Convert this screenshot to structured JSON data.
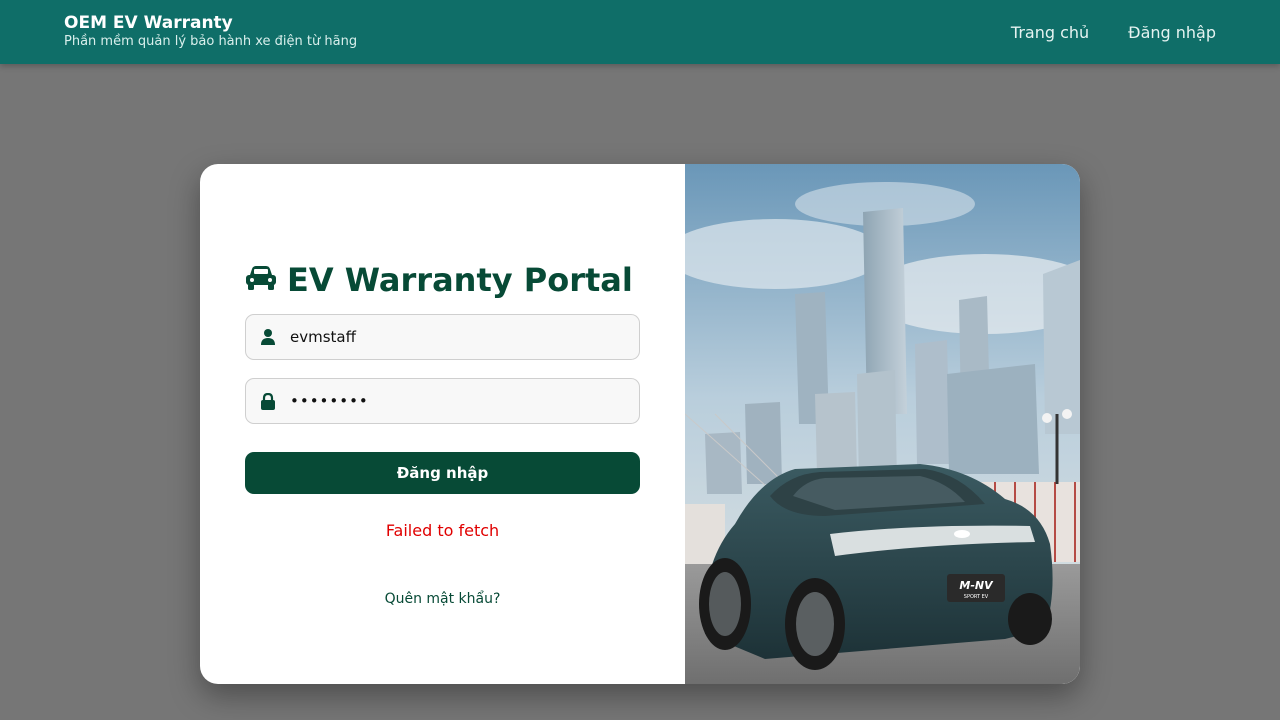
{
  "header": {
    "title": "OEM EV Warranty",
    "subtitle": "Phần mềm quản lý bảo hành xe điện từ hãng",
    "nav": [
      {
        "label": "Trang chủ"
      },
      {
        "label": "Đăng nhập"
      }
    ]
  },
  "login": {
    "title": "EV Warranty Portal",
    "username_value": "evmstaff",
    "password_value": "password",
    "submit_label": "Đăng nhập",
    "error_text": "Failed to fetch",
    "forgot_label": "Quên mật khẩu?"
  },
  "hero": {
    "plate_text": "M-NV",
    "plate_sub": "SPORT EV"
  },
  "icons": {
    "title_icon": "car-icon",
    "user_icon": "user-icon",
    "lock_icon": "lock-icon"
  },
  "colors": {
    "header_bg": "#0f6e68",
    "primary": "#074a36",
    "error": "#e00000",
    "page_bg": "#767676"
  }
}
